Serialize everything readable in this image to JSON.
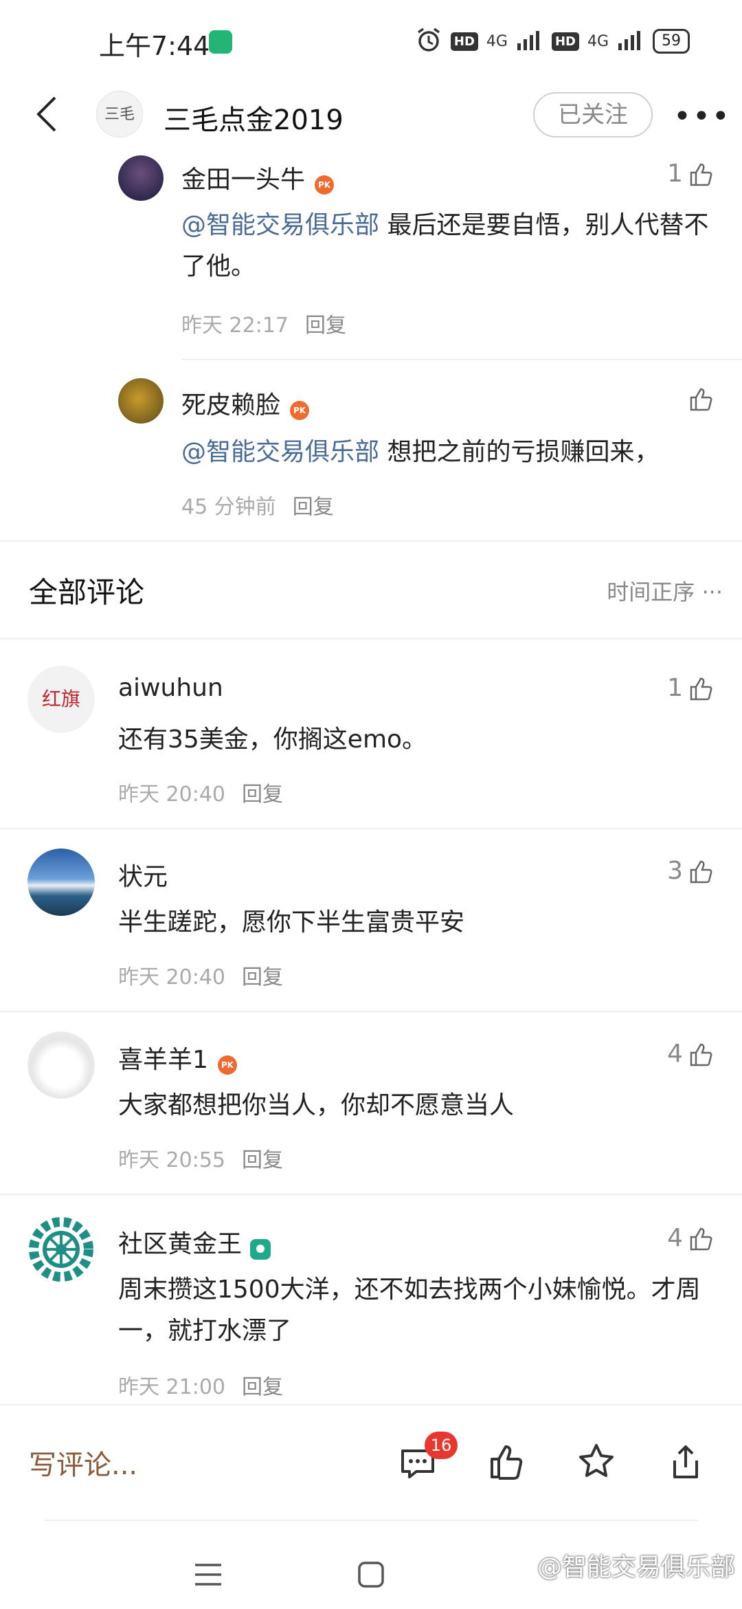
{
  "status": {
    "time": "上午7:44",
    "hd1": "HD",
    "net1": "4G",
    "hd2": "HD",
    "net2": "4G",
    "battery": "59"
  },
  "header": {
    "avatar_text": "三毛",
    "title": "三毛点金2019",
    "follow_label": "已关注",
    "more_label": "•••"
  },
  "replies": [
    {
      "name": "金田一头牛",
      "badge": "PK",
      "mention": "@智能交易俱乐部",
      "text": " 最后还是要自悟，别人代替不了他。",
      "time": "昨天 22:17",
      "reply": "回复",
      "likes": "1"
    },
    {
      "name": "死皮赖脸",
      "badge": "PK",
      "mention": "@智能交易俱乐部",
      "text": " 想把之前的亏损赚回来，",
      "time": "45 分钟前",
      "reply": "回复",
      "likes": ""
    }
  ],
  "section": {
    "title": "全部评论",
    "sort": "时间正序 ···"
  },
  "comments": [
    {
      "name": "aiwuhun",
      "avatar_text": "红旗",
      "text": "还有35美金，你搁这emo。",
      "time": "昨天 20:40",
      "reply": "回复",
      "likes": "1"
    },
    {
      "name": "状元",
      "text": "半生蹉跎，愿你下半生富贵平安",
      "time": "昨天 20:40",
      "reply": "回复",
      "likes": "3"
    },
    {
      "name": "喜羊羊1",
      "badge": "PK",
      "text": "大家都想把你当人，你却不愿意当人",
      "time": "昨天 20:55",
      "reply": "回复",
      "likes": "4"
    },
    {
      "name": "社区黄金王",
      "text": "周末攒这1500大洋，还不如去找两个小妹愉悦。才周一，就打水漂了",
      "time": "昨天 21:00",
      "reply": "回复",
      "likes": "4"
    }
  ],
  "bottom": {
    "write_placeholder": "写评论...",
    "comment_count": "16"
  },
  "watermark": "@智能交易俱乐部",
  "colors": {
    "mention": "#4a6b96",
    "pk_badge": "#f06a2d",
    "verified_badge": "#20a88a",
    "count_badge": "#e8372f",
    "write_text": "#8a5a3a"
  }
}
